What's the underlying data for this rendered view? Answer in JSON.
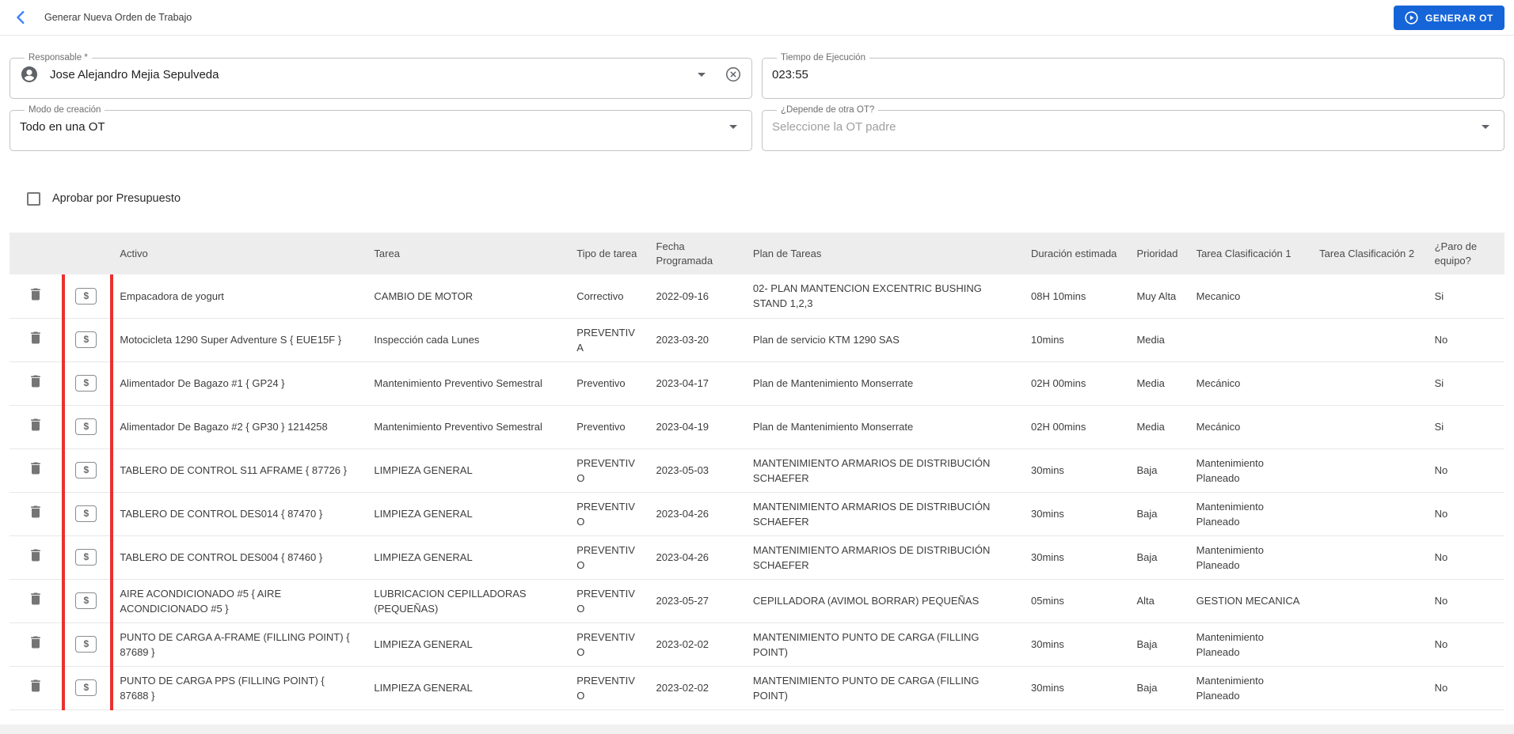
{
  "colors": {
    "accent": "#1665d8",
    "danger": "#e8312f",
    "back_arrow": "#4285f4"
  },
  "header": {
    "title": "Generar Nueva Orden de Trabajo",
    "generate_label": "GENERAR OT"
  },
  "form": {
    "responsable": {
      "label": "Responsable *",
      "value": "Jose Alejandro Mejia Sepulveda"
    },
    "tiempo": {
      "label": "Tiempo de Ejecución",
      "value": "023:55"
    },
    "modo": {
      "label": "Modo de creación",
      "value": "Todo en una OT"
    },
    "depende": {
      "label": "¿Depende de otra OT?",
      "placeholder": "Seleccione la OT padre"
    },
    "approve_checkbox_label": "Aprobar por Presupuesto"
  },
  "table": {
    "columns": [
      "Activo",
      "Tarea",
      "Tipo de tarea",
      "Fecha Programada",
      "Plan de Tareas",
      "Duración estimada",
      "Prioridad",
      "Tarea Clasificación 1",
      "Tarea Clasificación 2",
      "¿Paro de equipo?"
    ],
    "rows": [
      {
        "activo": "Empacadora de yogurt",
        "tarea": "CAMBIO DE MOTOR",
        "tipo": "Correctivo",
        "fecha": "2022-09-16",
        "plan": "02- PLAN MANTENCION EXCENTRIC BUSHING STAND 1,2,3",
        "duracion": "08H 10mins",
        "prioridad": "Muy Alta",
        "clasificacion1": "Mecanico",
        "clasificacion2": "",
        "paro": "Si"
      },
      {
        "activo": "Motocicleta 1290 Super Adventure S { EUE15F }",
        "tarea": "Inspección cada Lunes",
        "tipo": "PREVENTIVA",
        "fecha": "2023-03-20",
        "plan": "Plan de servicio KTM 1290 SAS",
        "duracion": "10mins",
        "prioridad": "Media",
        "clasificacion1": "",
        "clasificacion2": "",
        "paro": "No"
      },
      {
        "activo": "Alimentador De Bagazo #1 { GP24 }",
        "tarea": "Mantenimiento Preventivo Semestral",
        "tipo": "Preventivo",
        "fecha": "2023-04-17",
        "plan": "Plan de Mantenimiento Monserrate",
        "duracion": "02H 00mins",
        "prioridad": "Media",
        "clasificacion1": "Mecánico",
        "clasificacion2": "",
        "paro": "Si"
      },
      {
        "activo": "Alimentador De Bagazo #2 { GP30 } 1214258",
        "tarea": "Mantenimiento Preventivo Semestral",
        "tipo": "Preventivo",
        "fecha": "2023-04-19",
        "plan": "Plan de Mantenimiento Monserrate",
        "duracion": "02H 00mins",
        "prioridad": "Media",
        "clasificacion1": "Mecánico",
        "clasificacion2": "",
        "paro": "Si"
      },
      {
        "activo": "TABLERO DE CONTROL S11 AFRAME { 87726 }",
        "tarea": "LIMPIEZA GENERAL",
        "tipo": "PREVENTIVO",
        "fecha": "2023-05-03",
        "plan": "MANTENIMIENTO ARMARIOS DE DISTRIBUCIÓN SCHAEFER",
        "duracion": "30mins",
        "prioridad": "Baja",
        "clasificacion1": "Mantenimiento Planeado",
        "clasificacion2": "",
        "paro": "No"
      },
      {
        "activo": "TABLERO DE CONTROL DES014 { 87470 }",
        "tarea": "LIMPIEZA GENERAL",
        "tipo": "PREVENTIVO",
        "fecha": "2023-04-26",
        "plan": "MANTENIMIENTO ARMARIOS DE DISTRIBUCIÓN SCHAEFER",
        "duracion": "30mins",
        "prioridad": "Baja",
        "clasificacion1": "Mantenimiento Planeado",
        "clasificacion2": "",
        "paro": "No"
      },
      {
        "activo": "TABLERO DE CONTROL DES004 { 87460 }",
        "tarea": "LIMPIEZA GENERAL",
        "tipo": "PREVENTIVO",
        "fecha": "2023-04-26",
        "plan": "MANTENIMIENTO ARMARIOS DE DISTRIBUCIÓN SCHAEFER",
        "duracion": "30mins",
        "prioridad": "Baja",
        "clasificacion1": "Mantenimiento Planeado",
        "clasificacion2": "",
        "paro": "No"
      },
      {
        "activo": "AIRE ACONDICIONADO #5 { AIRE ACONDICIONADO #5 }",
        "tarea": "LUBRICACION CEPILLADORAS (PEQUEÑAS)",
        "tipo": "PREVENTIVO",
        "fecha": "2023-05-27",
        "plan": "CEPILLADORA (AVIMOL BORRAR) PEQUEÑAS",
        "duracion": "05mins",
        "prioridad": "Alta",
        "clasificacion1": "GESTION MECANICA",
        "clasificacion2": "",
        "paro": "No"
      },
      {
        "activo": "PUNTO DE CARGA A-FRAME (FILLING POINT) { 87689 }",
        "tarea": "LIMPIEZA GENERAL",
        "tipo": "PREVENTIVO",
        "fecha": "2023-02-02",
        "plan": "MANTENIMIENTO PUNTO DE CARGA (FILLING POINT)",
        "duracion": "30mins",
        "prioridad": "Baja",
        "clasificacion1": "Mantenimiento Planeado",
        "clasificacion2": "",
        "paro": "No"
      },
      {
        "activo": "PUNTO DE CARGA PPS (FILLING POINT) { 87688 }",
        "tarea": "LIMPIEZA GENERAL",
        "tipo": "PREVENTIVO",
        "fecha": "2023-02-02",
        "plan": "MANTENIMIENTO PUNTO DE CARGA (FILLING POINT)",
        "duracion": "30mins",
        "prioridad": "Baja",
        "clasificacion1": "Mantenimiento Planeado",
        "clasificacion2": "",
        "paro": "No"
      }
    ]
  }
}
